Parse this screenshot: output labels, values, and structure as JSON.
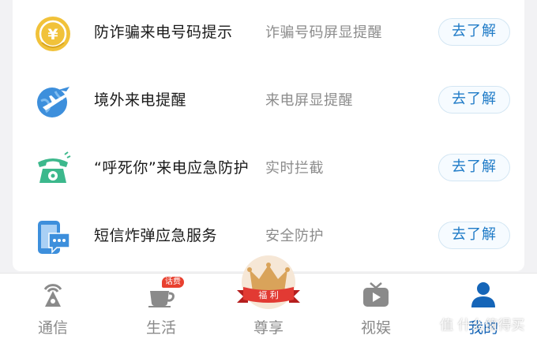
{
  "features": [
    {
      "icon": "yuan-coin-icon",
      "title": "防诈骗来电号码提示",
      "desc": "诈骗号码屏显提醒",
      "button": "去了解"
    },
    {
      "icon": "globe-airplane-icon",
      "title": "境外来电提醒",
      "desc": "来电屏显提醒",
      "button": "去了解"
    },
    {
      "icon": "telephone-alert-icon",
      "title": "“呼死你”来电应急防护",
      "desc": "实时拦截",
      "button": "去了解"
    },
    {
      "icon": "sms-phone-icon",
      "title": "短信炸弹应急服务",
      "desc": "安全防护",
      "button": "去了解"
    }
  ],
  "tabbar": {
    "tabs": [
      {
        "label": "通信",
        "icon": "signal-tower-icon"
      },
      {
        "label": "生活",
        "icon": "coffee-cup-icon",
        "badge": "话费"
      },
      {
        "label": "尊享",
        "icon": "crown-icon",
        "ribbon": "福 利"
      },
      {
        "label": "视娱",
        "icon": "tv-play-icon"
      },
      {
        "label": "我的",
        "icon": "user-icon"
      }
    ],
    "active": "我的"
  },
  "watermark": "值 什么值得买",
  "colors": {
    "accent": "#1f7bc7",
    "active_tab": "#1565b8",
    "inactive_tab": "#8a8a8a",
    "badge": "#e8402f"
  }
}
